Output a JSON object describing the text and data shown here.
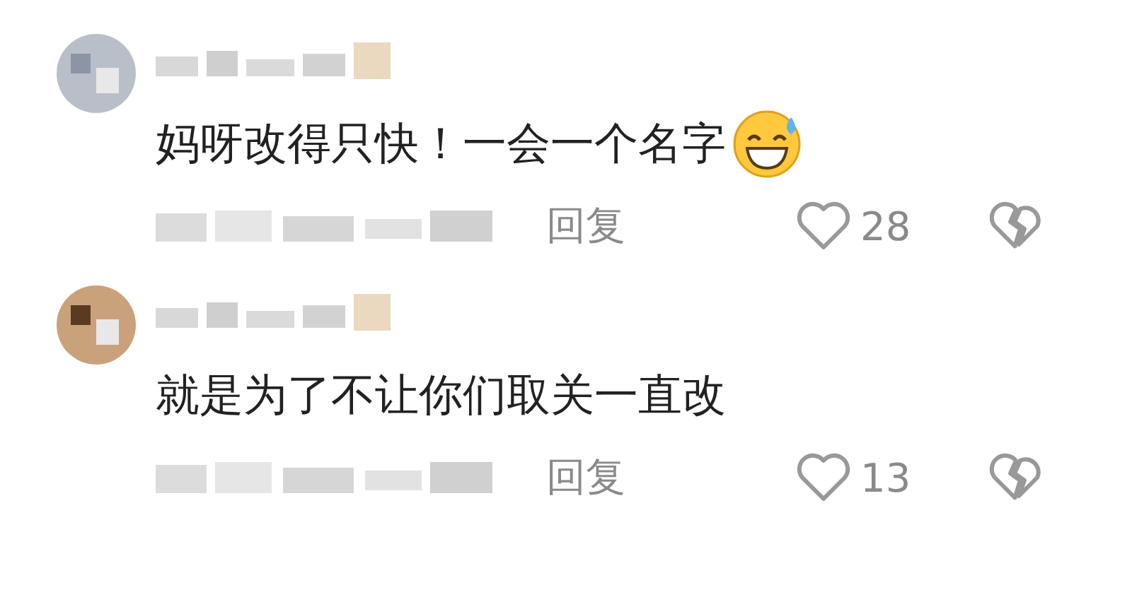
{
  "comments": [
    {
      "text": "妈呀改得只快！一会一个名字",
      "emoji": true,
      "reply": "回复",
      "likes": "28"
    },
    {
      "text": "就是为了不让你们取关一直改",
      "emoji": false,
      "reply": "回复",
      "likes": "13"
    }
  ]
}
